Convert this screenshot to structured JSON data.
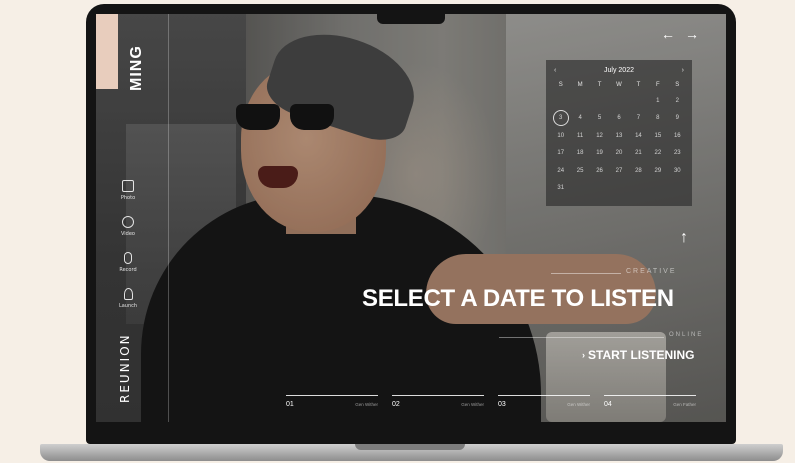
{
  "brand": {
    "name": "MING",
    "logo": "REUNION"
  },
  "nav": [
    {
      "label": "Photo",
      "icon": "image-icon"
    },
    {
      "label": "Video",
      "icon": "play-icon"
    },
    {
      "label": "Record",
      "icon": "microphone-icon"
    },
    {
      "label": "Launch",
      "icon": "rocket-icon"
    }
  ],
  "calendar": {
    "month": "July 2022",
    "prev": "‹",
    "next": "›",
    "weekdays": [
      "S",
      "M",
      "T",
      "W",
      "T",
      "F",
      "S"
    ],
    "weeks": [
      [
        "",
        "",
        "",
        "",
        "",
        "1",
        "2"
      ],
      [
        "3",
        "4",
        "5",
        "6",
        "7",
        "8",
        "9"
      ],
      [
        "10",
        "11",
        "12",
        "13",
        "14",
        "15",
        "16"
      ],
      [
        "17",
        "18",
        "19",
        "20",
        "21",
        "22",
        "23"
      ],
      [
        "24",
        "25",
        "26",
        "27",
        "28",
        "29",
        "30"
      ],
      [
        "31",
        "",
        "",
        "",
        "",
        "",
        ""
      ]
    ],
    "selected": "3"
  },
  "arrows": {
    "left": "←",
    "right": "→",
    "up": "↑"
  },
  "hero": {
    "tag_top": "CREATIVE",
    "headline": "SELECT A DATE TO LISTEN",
    "tag_bottom": "ONLINE",
    "cta": "START LISTENING",
    "cta_icon": "chevron-right-icon"
  },
  "timeline": [
    {
      "num": "01",
      "sub": "Gen Wither"
    },
    {
      "num": "02",
      "sub": "Gen Wither"
    },
    {
      "num": "03",
      "sub": "Gen Wither"
    },
    {
      "num": "04",
      "sub": "Gen Father"
    }
  ],
  "colors": {
    "accent_tab": "#e8cdbd",
    "bezel": "#141414",
    "background": "#f6efe6"
  }
}
